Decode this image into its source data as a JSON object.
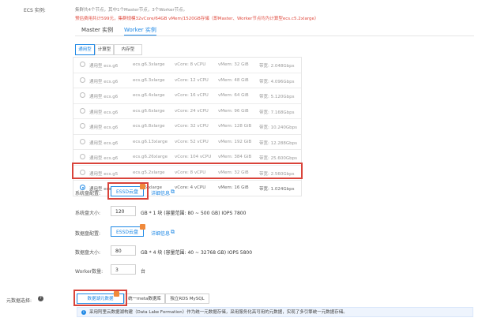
{
  "ecs": {
    "label": "ECS 实例:",
    "note1": "集群共4个节点，其中1个Master节点，3个Worker节点。",
    "note2": "预估费用共计599元，集群规模32vCore/64GB vMem/1520GB存储（即Master、Worker节点均为计算型ecs.c5.2xlarge）",
    "tabs": [
      "Master 实例",
      "Worker 实例"
    ],
    "subtabs": [
      "通用型",
      "计算型",
      "内存型"
    ]
  },
  "instances": [
    {
      "family": "通用型 ecs.g6",
      "type": "ecs.g6.3xlarge",
      "vcore": "vCore: 8 vCPU",
      "vmem": "vMem: 32 GiB",
      "bw": "带宽: 2.048Gbps",
      "selected": false
    },
    {
      "family": "通用型 ecs.g6",
      "type": "ecs.g6.3xlarge",
      "vcore": "vCore: 12 vCPU",
      "vmem": "vMem: 48 GiB",
      "bw": "带宽: 4.096Gbps",
      "selected": false
    },
    {
      "family": "通用型 ecs.g6",
      "type": "ecs.g6.4xlarge",
      "vcore": "vCore: 16 vCPU",
      "vmem": "vMem: 64 GiB",
      "bw": "带宽: 5.120Gbps",
      "selected": false
    },
    {
      "family": "通用型 ecs.g6",
      "type": "ecs.g6.6xlarge",
      "vcore": "vCore: 24 vCPU",
      "vmem": "vMem: 96 GiB",
      "bw": "带宽: 7.168Gbps",
      "selected": false
    },
    {
      "family": "通用型 ecs.g6",
      "type": "ecs.g6.8xlarge",
      "vcore": "vCore: 32 vCPU",
      "vmem": "vMem: 128 GiB",
      "bw": "带宽: 10.240Gbps",
      "selected": false
    },
    {
      "family": "通用型 ecs.g6",
      "type": "ecs.g6.13xlarge",
      "vcore": "vCore: 52 vCPU",
      "vmem": "vMem: 192 GiB",
      "bw": "带宽: 12.288Gbps",
      "selected": false
    },
    {
      "family": "通用型 ecs.g6",
      "type": "ecs.g6.26xlarge",
      "vcore": "vCore: 104 vCPU",
      "vmem": "vMem: 384 GiB",
      "bw": "带宽: 25.600Gbps",
      "selected": false
    },
    {
      "family": "通用型 ecs.g5",
      "type": "ecs.g5.2xlarge",
      "vcore": "vCore: 8 vCPU",
      "vmem": "vMem: 32 GiB",
      "bw": "带宽: 2.560Gbps",
      "selected": false
    },
    {
      "family": "通用型 ecs.g6",
      "type": "ecs.g6.xlarge",
      "vcore": "vCore: 4 vCPU",
      "vmem": "vMem: 16 GiB",
      "bw": "带宽: 1.024Gbps",
      "selected": true
    }
  ],
  "system_disk": {
    "label": "系统盘配置:",
    "button": "ESSD云盘",
    "link": "详细信息",
    "size_label": "系统盘大小:",
    "size_value": "120",
    "size_desc": "GB * 1 块 (容量范围: 80 ~ 500 GB)  IOPS 7800"
  },
  "data_disk": {
    "label": "数据盘配置:",
    "button": "ESSD云盘",
    "link": "详细信息",
    "size_label": "数据盘大小:",
    "size_value": "80",
    "size_desc": "GB * 4 块 (容量范围: 40 ~ 32768 GB)  IOPS 5800"
  },
  "worker": {
    "label": "Worker数量:",
    "value": "3",
    "unit": "台"
  },
  "metadata": {
    "label": "元数据选择:",
    "help_icon": "?",
    "options": [
      "数据湖元数据",
      "统一meta数据库",
      "独立RDS MySQL"
    ],
    "info_icon": "i",
    "info": "采用阿里云数据湖构建（Data Lake Formation）作为统一元数据存储，采用服务化高可用的元数据，实现了多引擎统一元数据存储。"
  },
  "colors": {
    "accent": "#1e88e5",
    "highlight": "#d9433a",
    "warning": "#e04b3f",
    "tag": "#f0893a"
  }
}
